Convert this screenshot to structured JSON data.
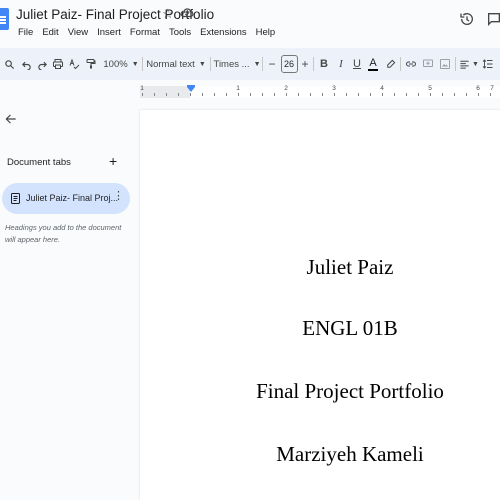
{
  "header": {
    "title": "Juliet Paiz- Final Project Portfolio",
    "menu": [
      "File",
      "Edit",
      "View",
      "Insert",
      "Format",
      "Tools",
      "Extensions",
      "Help"
    ]
  },
  "toolbar": {
    "zoom": "100%",
    "style": "Normal text",
    "font": "Times ...",
    "font_size": "26",
    "bold": "B",
    "italic": "I",
    "underline": "U",
    "text_color": "A"
  },
  "ruler": {
    "numbers": [
      "1",
      "1",
      "2",
      "3",
      "4",
      "5",
      "6",
      "7"
    ]
  },
  "sidebar": {
    "tabs_heading": "Document tabs",
    "tab_label": "Juliet Paiz- Final Proj...",
    "hint": "Headings you add to the document will appear here."
  },
  "document": {
    "lines": [
      "Juliet Paiz",
      "ENGL 01B",
      "Final Project Portfolio",
      "Marziyeh Kameli"
    ]
  },
  "colors": {
    "accent": "#4285f4",
    "toolbar_bg": "#edf2fa",
    "tab_selected_bg": "#d3e3fd"
  }
}
